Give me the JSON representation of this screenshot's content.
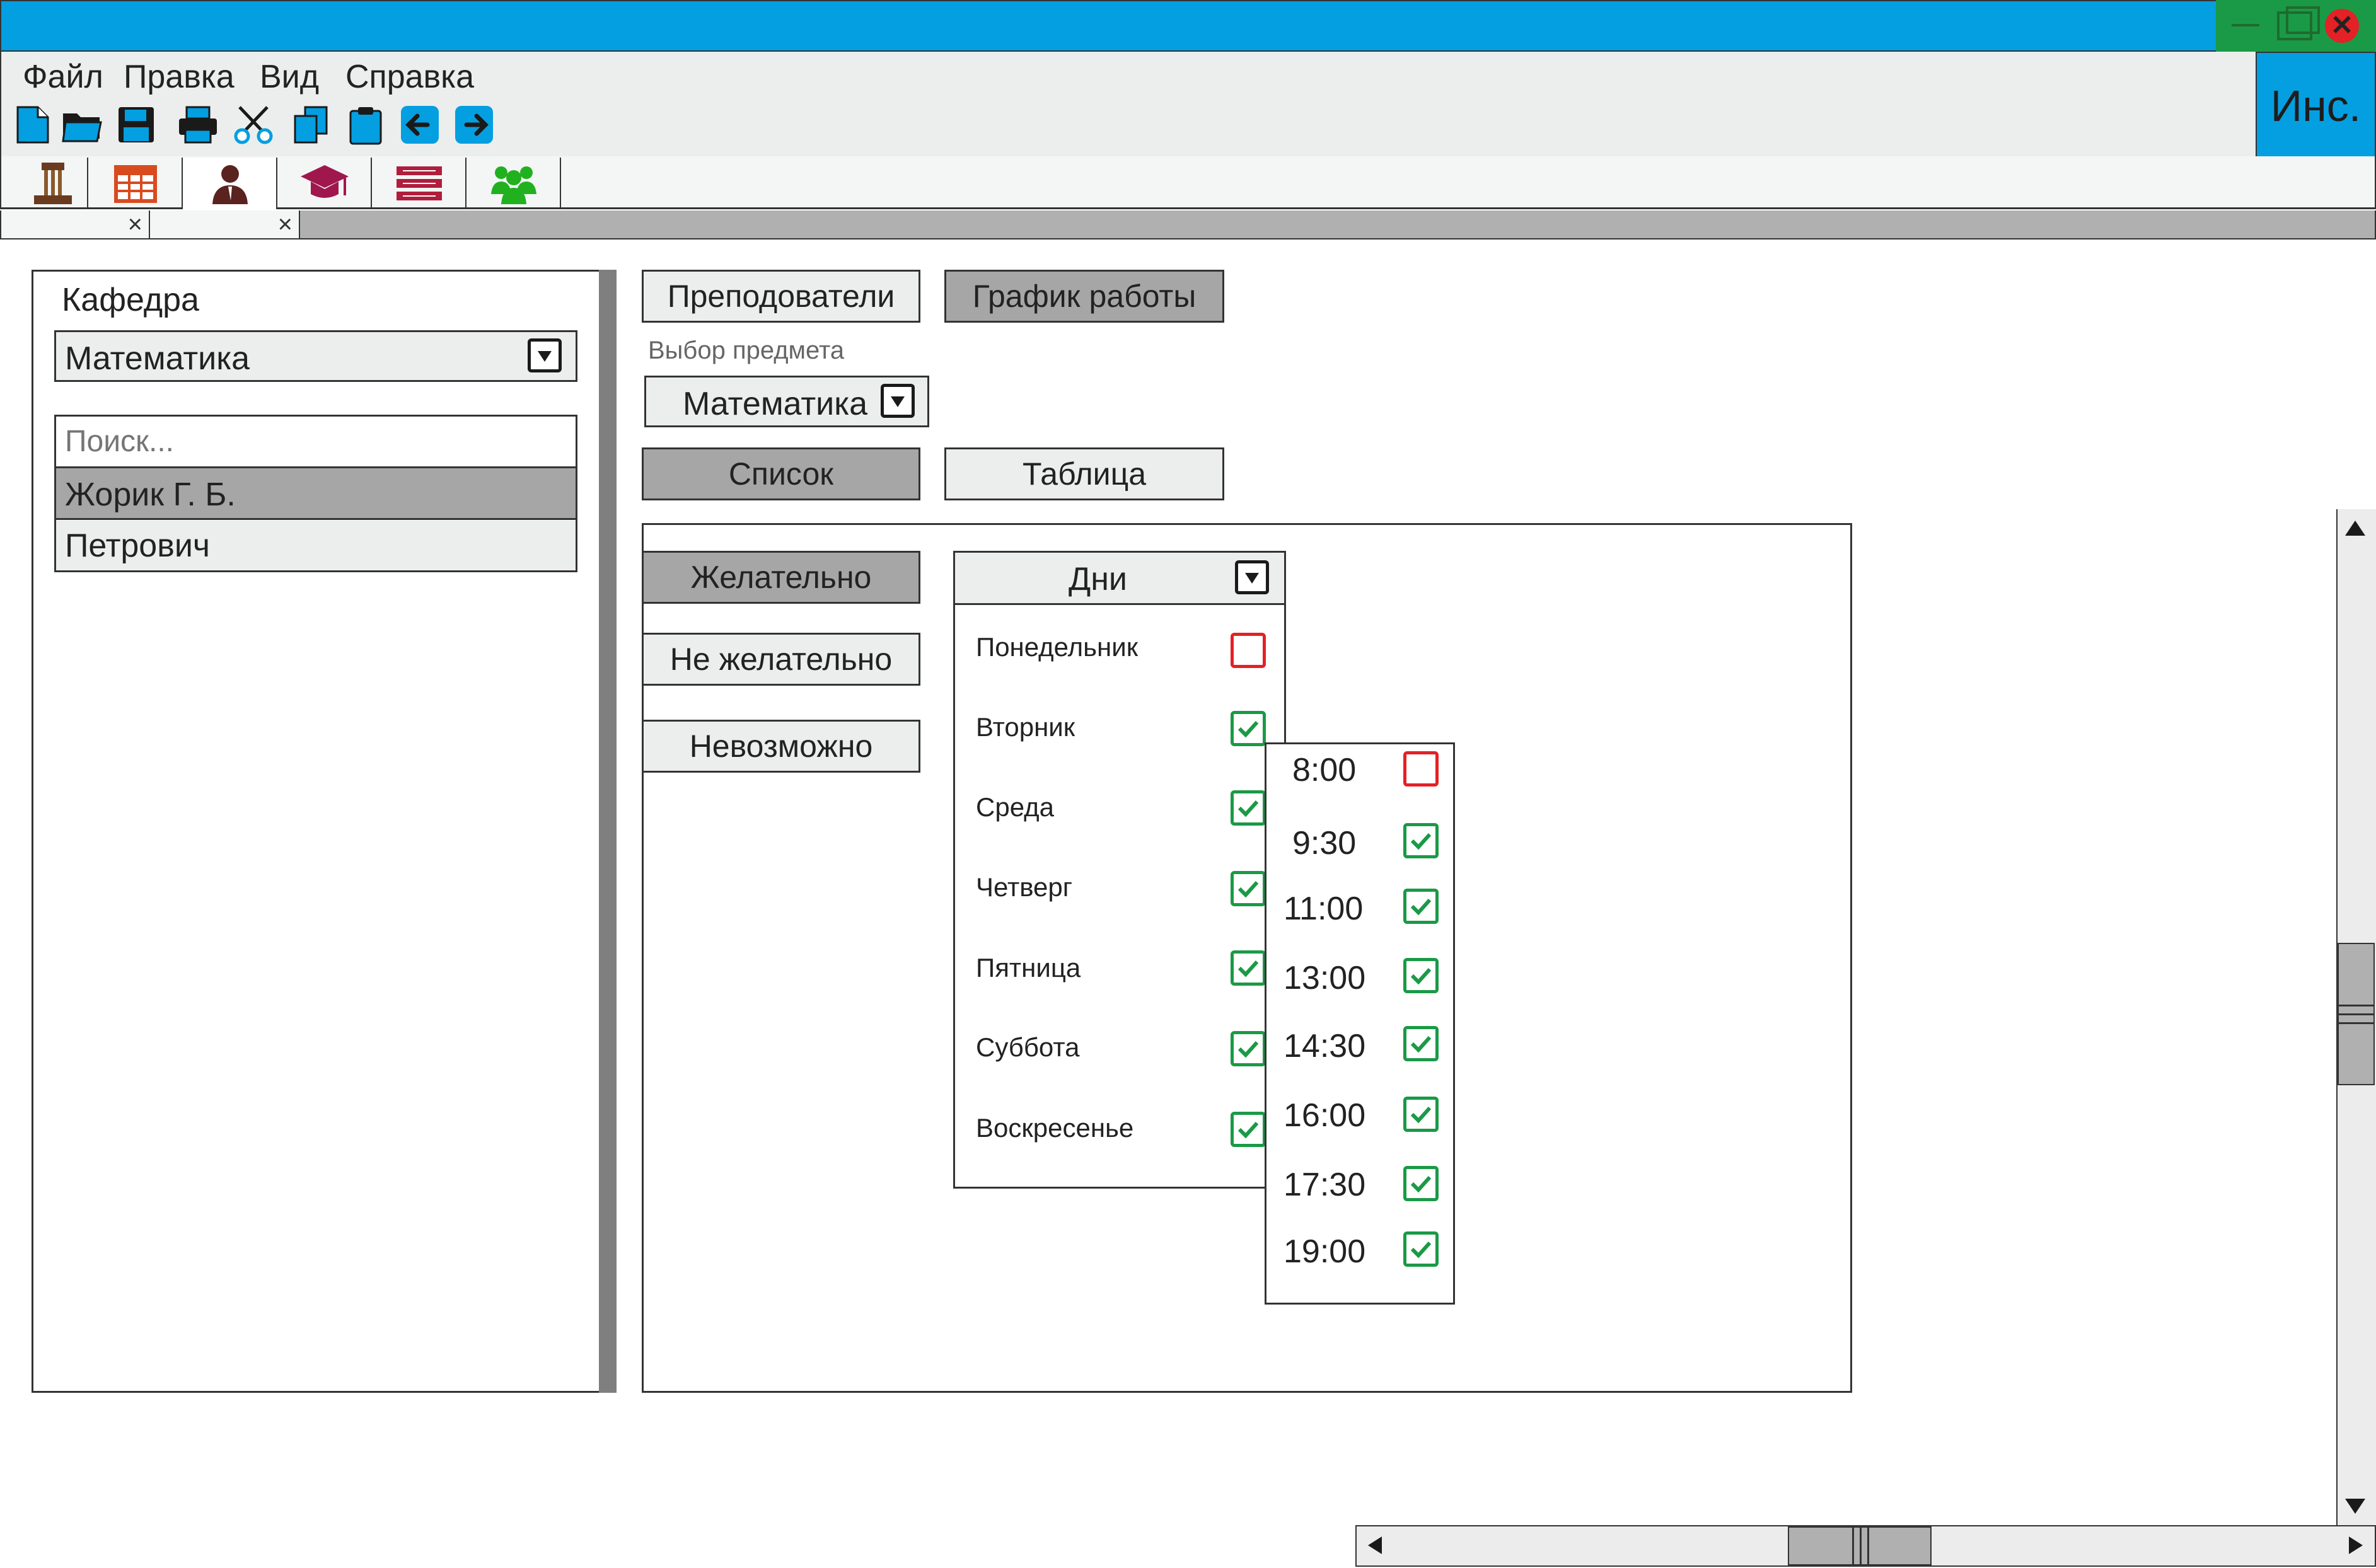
{
  "window": {
    "title_bar_color": "#049fe0",
    "controls": [
      "minimize-icon",
      "maximize-icon",
      "close-icon"
    ],
    "user_button_label": "Инс."
  },
  "menu": {
    "items": [
      "Файл",
      "Правка",
      "Вид",
      "Справка"
    ]
  },
  "toolbar": {
    "icons": [
      "new-file-icon",
      "open-folder-icon",
      "save-icon",
      "print-icon",
      "cut-icon",
      "copy-icon",
      "paste-icon",
      "back-arrow-icon",
      "forward-arrow-icon"
    ]
  },
  "nav_tabs": {
    "icons": [
      "court-building-icon",
      "calendar-icon",
      "teacher-icon",
      "graduation-cap-icon",
      "books-icon",
      "group-icon"
    ],
    "active_index": 2
  },
  "left_panel": {
    "department_label": "Кафедра",
    "department_value": "Математика",
    "search_placeholder": "Поиск...",
    "teachers": [
      "Жорик Г. Б.",
      "Петрович"
    ],
    "selected_teacher_index": 0
  },
  "top_buttons": {
    "teachers": "Преподователи",
    "schedule": "График работы"
  },
  "subject": {
    "label": "Выбор предмета",
    "value": "Математика"
  },
  "view_buttons": {
    "list": "Список",
    "table": "Таблица"
  },
  "preference_buttons": [
    "Желательно",
    "Не желательно",
    "Невозможно"
  ],
  "days_dropdown": {
    "label": "Дни",
    "days": [
      {
        "name": "Понедельник",
        "checked": false
      },
      {
        "name": "Вторник",
        "checked": true
      },
      {
        "name": "Среда",
        "checked": true
      },
      {
        "name": "Четверг",
        "checked": true
      },
      {
        "name": "Пятница",
        "checked": true
      },
      {
        "name": "Суббота",
        "checked": true
      },
      {
        "name": "Воскресенье",
        "checked": true
      }
    ]
  },
  "times_popup": {
    "times": [
      {
        "time": "8:00",
        "checked": false
      },
      {
        "time": "9:30",
        "checked": true
      },
      {
        "time": "11:00",
        "checked": true
      },
      {
        "time": "13:00",
        "checked": true
      },
      {
        "time": "14:30",
        "checked": true
      },
      {
        "time": "16:00",
        "checked": true
      },
      {
        "time": "17:30",
        "checked": true
      },
      {
        "time": "19:00",
        "checked": true
      }
    ]
  },
  "colors": {
    "accent_blue": "#049fe0",
    "check_green": "#1a9a46",
    "check_red": "#e32126",
    "selected_gray": "#a6a6a6"
  }
}
